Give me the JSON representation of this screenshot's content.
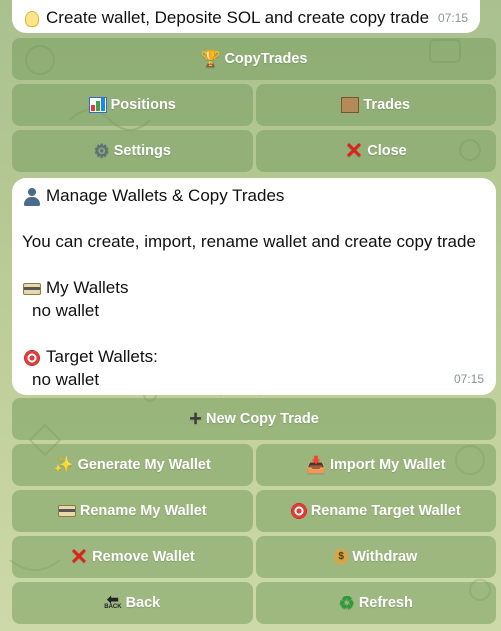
{
  "top_message": {
    "icon": "lightbulb-icon",
    "text": "Create wallet, Deposite SOL and create copy trade",
    "time": "07:15"
  },
  "top_keyboard": {
    "copytrades": {
      "icon": "trophy-icon",
      "label": "CopyTrades"
    },
    "positions": {
      "icon": "bar-chart-icon",
      "label": "Positions"
    },
    "trades": {
      "icon": "scroll-icon",
      "label": "Trades"
    },
    "settings": {
      "icon": "gear-icon",
      "label": "Settings"
    },
    "close": {
      "icon": "cross-mark-icon",
      "label": "Close"
    }
  },
  "main_message": {
    "title_icon": "person-icon",
    "title": "Manage Wallets & Copy Trades",
    "description": "You can create, import, rename wallet and create copy trade",
    "my_wallets_icon": "credit-card-icon",
    "my_wallets_label": "My Wallets",
    "my_wallets_value": "no wallet",
    "target_wallets_icon": "target-icon",
    "target_wallets_label": "Target Wallets:",
    "target_wallets_value": "no wallet",
    "time": "07:15"
  },
  "bottom_keyboard": {
    "new_copy_trade": {
      "icon": "plus-icon",
      "label": "New Copy Trade"
    },
    "generate_wallet": {
      "icon": "sparkles-icon",
      "label": "Generate My Wallet"
    },
    "import_wallet": {
      "icon": "inbox-tray-icon",
      "label": "Import My Wallet"
    },
    "rename_wallet": {
      "icon": "credit-card-icon",
      "label": "Rename My Wallet"
    },
    "rename_target": {
      "icon": "target-icon",
      "label": "Rename Target Wallet"
    },
    "remove_wallet": {
      "icon": "cross-mark-icon",
      "label": "Remove Wallet"
    },
    "withdraw": {
      "icon": "money-bag-icon",
      "label": "Withdraw"
    },
    "back": {
      "icon": "back-arrow-icon",
      "label": "Back",
      "icon_text": "BACK"
    },
    "refresh": {
      "icon": "recycle-icon",
      "label": "Refresh"
    }
  }
}
